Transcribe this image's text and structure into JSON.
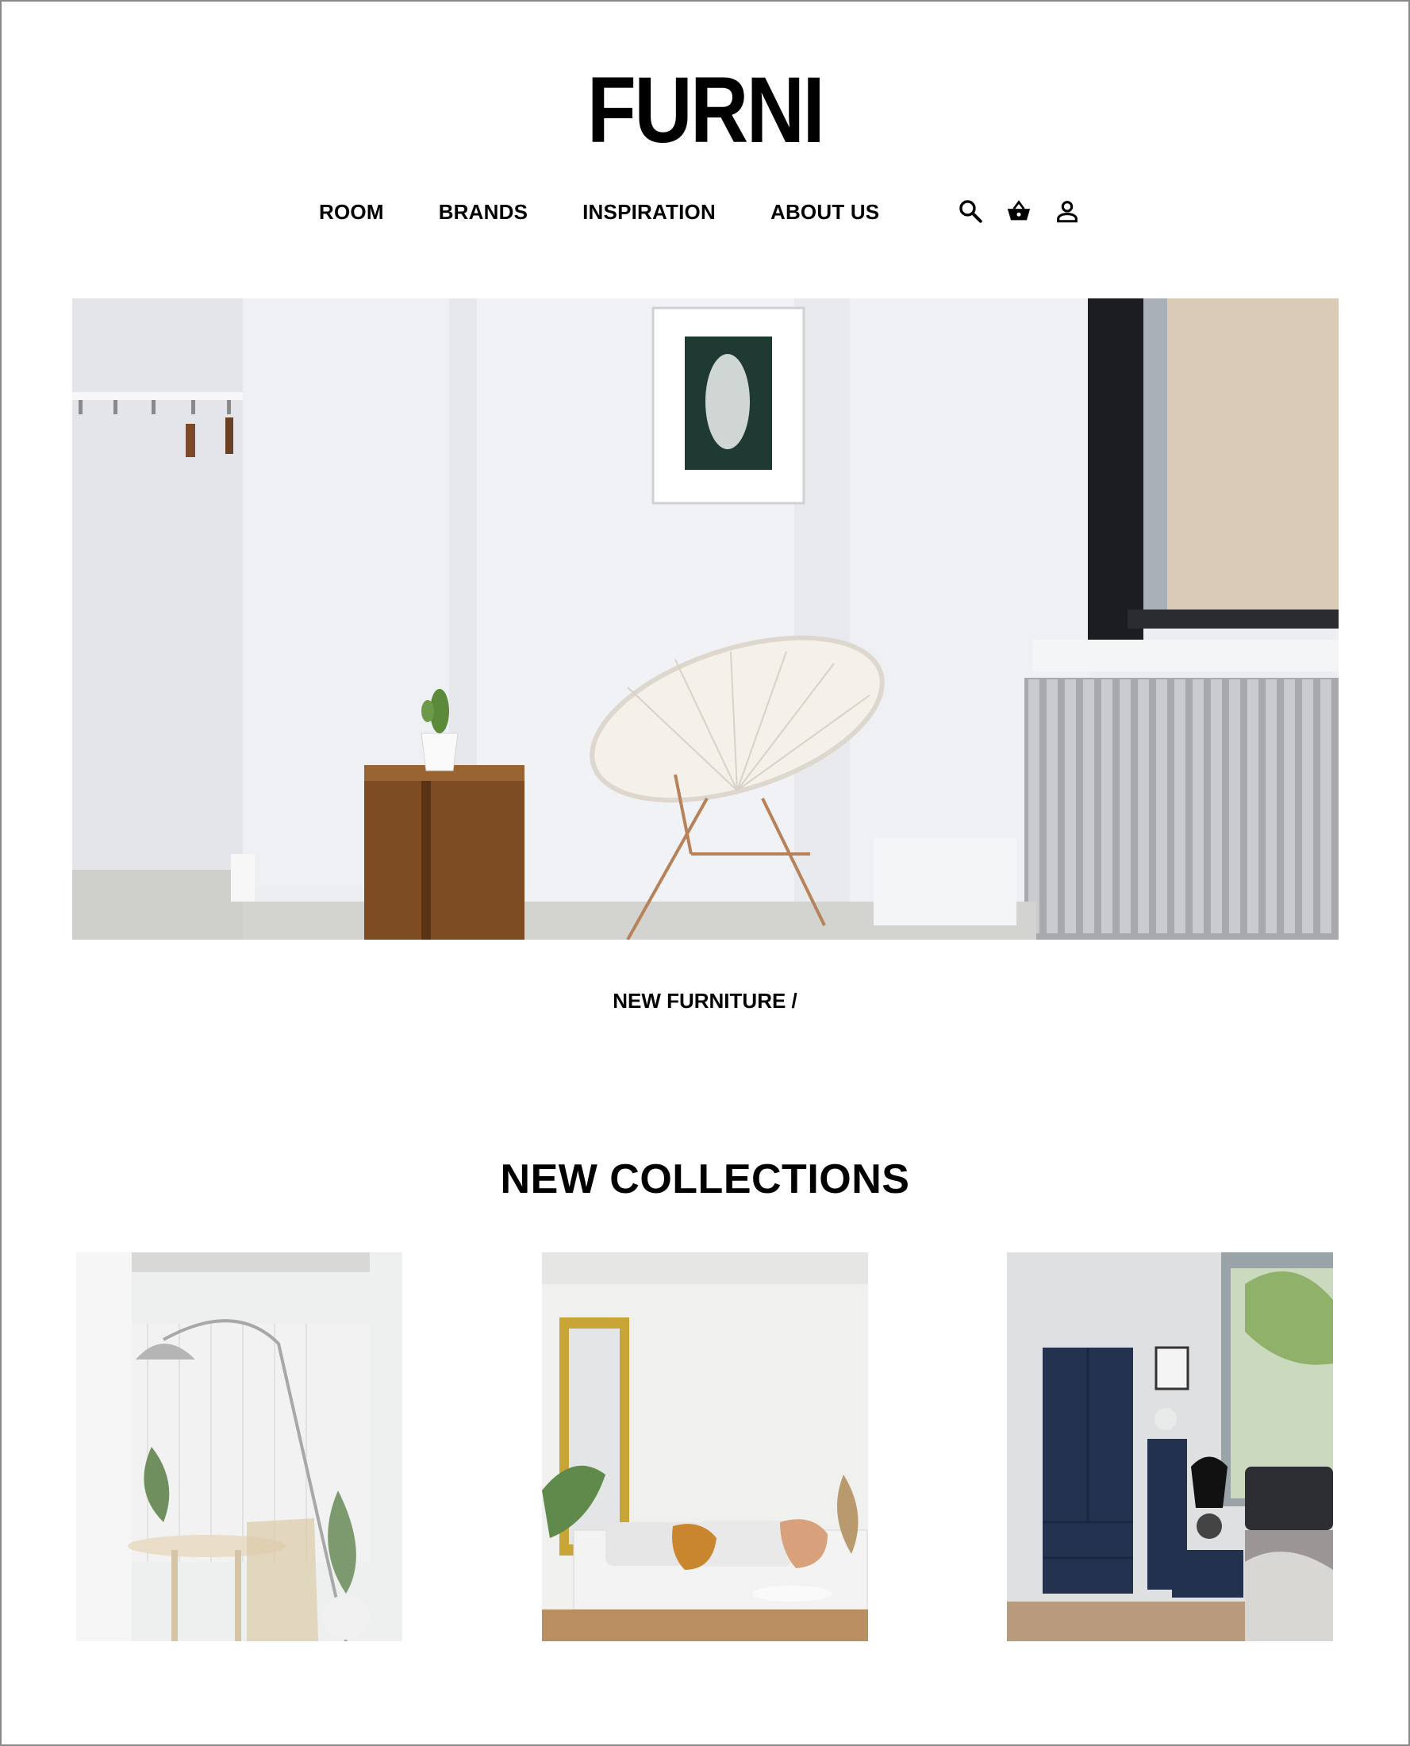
{
  "brand": {
    "logo": "FURNI"
  },
  "nav": {
    "items": [
      {
        "label": "ROOM"
      },
      {
        "label": "BRANDS"
      },
      {
        "label": "INSPIRATION"
      },
      {
        "label": "ABOUT US"
      }
    ],
    "icons": [
      "search-icon",
      "basket-icon",
      "user-icon"
    ]
  },
  "hero": {
    "image": "minimal white room with wooden stool, cactus, white round chair, framed print, radiator and window",
    "caption": "NEW FURNITURE /"
  },
  "collections": {
    "title": "NEW COLLECTIONS",
    "items": [
      {
        "image": "white room with arc floor lamp, round wooden table, chair and plants"
      },
      {
        "image": "living room with gold framed mirror, white sofa, cushions and side table"
      },
      {
        "image": "bedroom with navy wardrobe, drawers, bedside table with black lamp and bed"
      }
    ]
  },
  "colors": {
    "text": "#000000",
    "background": "#ffffff",
    "border": "#8a8a8a"
  }
}
